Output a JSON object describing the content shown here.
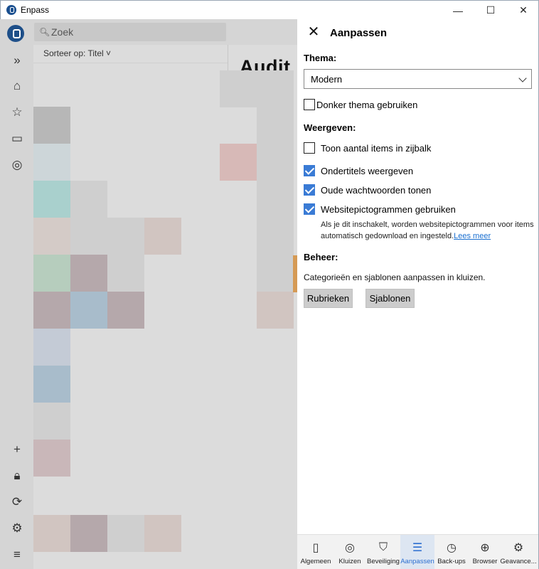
{
  "window": {
    "title": "Enpass",
    "minimize": "—",
    "maximize": "☐",
    "close": "✕"
  },
  "app": {
    "search_placeholder": "Zoek",
    "sort_label": "Sorteer op: Titel ˅",
    "audit_title": "Audit",
    "tile_colors": [
      "#b7b7b7",
      "#cdd6d9",
      "#a9d0cd",
      "#d4cbc7",
      "#b6cdbd",
      "#b5a8ab",
      "#c4cbd6",
      "#a8bccb",
      "#cfcfcf",
      "#c9b7b9",
      "#d1c5c1",
      "#d7b9b7"
    ]
  },
  "panel": {
    "title": "Aanpassen",
    "thema_label": "Thema:",
    "thema_value": "Modern",
    "dark_theme_label": "Donker thema gebruiken",
    "weergeven_label": "Weergeven:",
    "options": [
      {
        "label": "Toon aantal items in zijbalk",
        "checked": false
      },
      {
        "label": "Ondertitels weergeven",
        "checked": true
      },
      {
        "label": "Oude wachtwoorden tonen",
        "checked": true
      },
      {
        "label": "Websitepictogrammen gebruiken",
        "checked": true
      }
    ],
    "help_text": "Als je dit inschakelt, worden websitepictogrammen voor items automatisch gedownload en ingesteld.",
    "help_link": "Lees meer",
    "beheer_label": "Beheer:",
    "beheer_desc": "Categorieën en sjablonen aanpassen in kluizen.",
    "btn_rubrieken": "Rubrieken",
    "btn_sjablonen": "Sjablonen"
  },
  "tabs": [
    {
      "label": "Algemeen",
      "icon": "phone-icon"
    },
    {
      "label": "Kluizen",
      "icon": "vault-icon"
    },
    {
      "label": "Beveiliging",
      "icon": "shield-icon"
    },
    {
      "label": "Aanpassen",
      "icon": "sliders-icon",
      "active": true
    },
    {
      "label": "Back-ups",
      "icon": "backup-icon"
    },
    {
      "label": "Browser",
      "icon": "globe-icon"
    },
    {
      "label": "Geavance...",
      "icon": "gear-icon"
    }
  ],
  "colors": {
    "accent": "#3a7bd5",
    "link": "#1a6fd0",
    "brand": "#1e4f89"
  }
}
